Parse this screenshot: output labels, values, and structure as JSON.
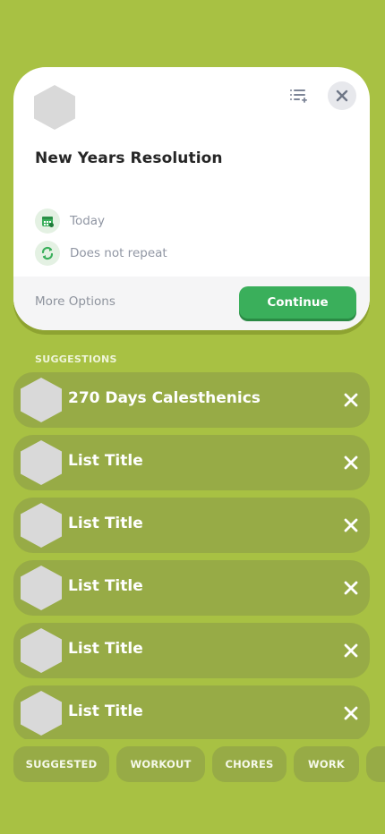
{
  "card": {
    "title": "New Years Resolution",
    "date_label": "Today",
    "repeat_label": "Does not repeat",
    "more_options_label": "More Options",
    "continue_label": "Continue"
  },
  "suggestions": {
    "section_label": "SUGGESTIONS",
    "items": [
      {
        "title": "270 Days Calesthenics"
      },
      {
        "title": "List Title"
      },
      {
        "title": "List Title"
      },
      {
        "title": "List Title"
      },
      {
        "title": "List Title"
      },
      {
        "title": "List Title"
      }
    ]
  },
  "tabs": [
    {
      "label": "SUGGESTED"
    },
    {
      "label": "WORKOUT"
    },
    {
      "label": "CHORES"
    },
    {
      "label": "WORK"
    }
  ],
  "colors": {
    "background": "#a8c143",
    "accent_green": "#3aaf5b",
    "pill": "#97ab46"
  },
  "icons": {
    "list_add": "list-add-icon",
    "close": "close-icon",
    "calendar": "calendar-icon",
    "repeat": "repeat-icon",
    "remove": "x-icon"
  }
}
